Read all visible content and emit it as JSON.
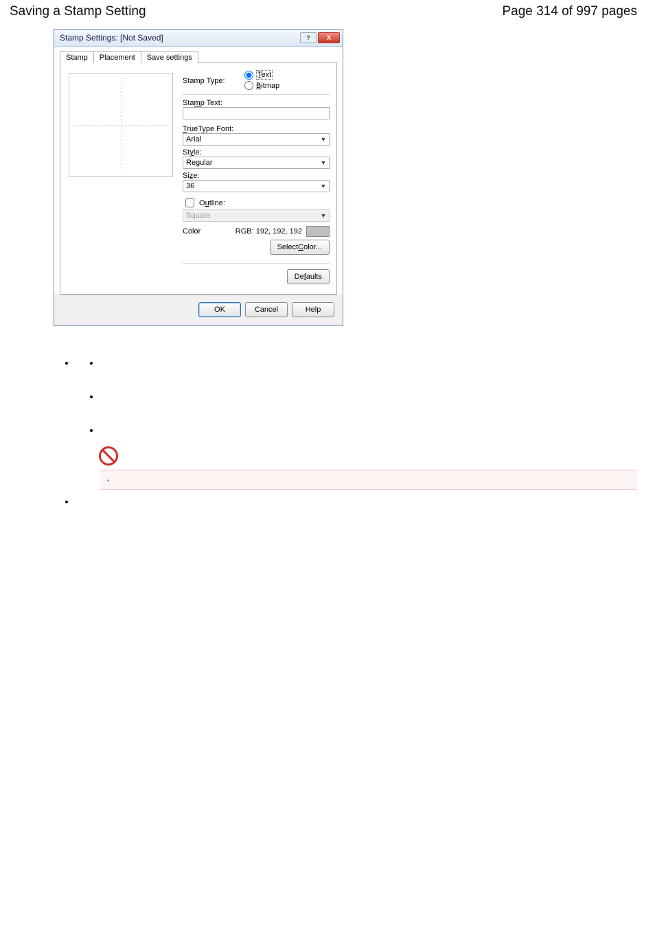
{
  "page": {
    "title_left": "Saving a Stamp Setting",
    "title_right": "Page 314 of 997 pages"
  },
  "dialog": {
    "title": "Stamp Settings: [Not Saved]",
    "tabs": [
      "Stamp",
      "Placement",
      "Save settings"
    ],
    "labels": {
      "stamp_type": "Stamp Type:",
      "radio_text": "Text",
      "radio_bitmap": "Bitmap",
      "stamp_text": "Stamp Text:",
      "font": "TrueType Font:",
      "style": "Style:",
      "size": "Size:",
      "outline": "Outline:",
      "color": "Color",
      "select_color": "Select Color...",
      "defaults": "Defaults"
    },
    "values": {
      "font": "Arial",
      "style": "Regular",
      "size": "36",
      "outline_shape": "Square",
      "color_text": "RGB: 192, 192, 192"
    },
    "buttons": {
      "ok": "OK",
      "cancel": "Cancel",
      "help": "Help"
    }
  }
}
